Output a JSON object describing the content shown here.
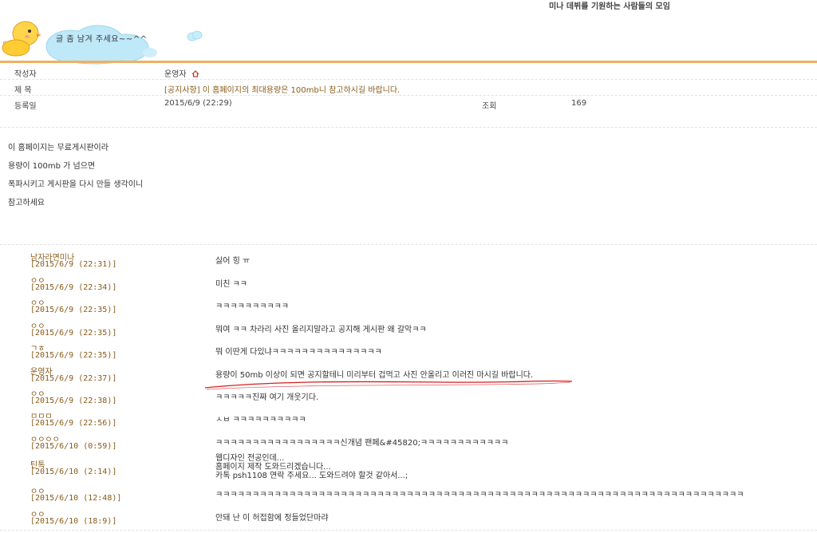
{
  "site_title": "미나 데뷔를 기원하는 사람들의 모임",
  "logo": {
    "cloud_text": "글 좀 남겨 주세요~~^^"
  },
  "post": {
    "writer_label": "작성자",
    "writer_value": "운영자",
    "subject_label": "제 목",
    "subject_value": "[공지사항] 이 홈페이지의 최대용량은 100mb니 참고하시길 바랍니다.",
    "date_label": "등록일",
    "date_value": "2015/6/9 (22:29)",
    "views_label": "조회",
    "views_value": "169",
    "body_lines": [
      "이 홈페이지는 무료게시판이라",
      "용량이 100mb 가 넘으면",
      "폭파시키고 게시판을 다시 만들 생각이니",
      "참고하세요"
    ]
  },
  "comments": [
    {
      "author": "남자라면미나",
      "date": "[2015/6/9 (22:31)]",
      "text": "싫어 힝 ㅠ"
    },
    {
      "author": "ㅇㅇ",
      "date": "[2015/6/9 (22:34)]",
      "text": "미친 ㅋㅋ"
    },
    {
      "author": "ㅇㅇ",
      "date": "[2015/6/9 (22:35)]",
      "text": "ㅋㅋㅋㅋㅋㅋㅋㅋㅋㅋ"
    },
    {
      "author": "ㅇㅇ",
      "date": "[2015/6/9 (22:35)]",
      "text": "뭐여 ㅋㅋ 차라리 사진 올리지말라고 공지해 게시판 왜 갈악ㅋㅋ"
    },
    {
      "author": "ㄱㅎ",
      "date": "[2015/6/9 (22:35)]",
      "text": "뭐 이딴게 다있냐ㅋㅋㅋㅋㅋㅋㅋㅋㅋㅋㅋㅋㅋㅋㅋ"
    },
    {
      "author": "운영자",
      "date": "[2015/6/9 (22:37)]",
      "text": "용량이 50mb 이상이 되면 공지할테니 미리부터 겁먹고 사진 안올리고 이러진 마시길 바랍니다."
    },
    {
      "author": "ㅇㅇ",
      "date": "[2015/6/9 (22:38)]",
      "text": "ㅋㅋㅋㅋㅋ진짜 여기 개웃기다."
    },
    {
      "author": "ㅁㅁㅁ",
      "date": "[2015/6/9 (22:56)]",
      "text": "ㅅㅂ ㅋㅋㅋㅋㅋㅋㅋㅋㅋㅋ"
    },
    {
      "author": "ㅇㅇㅇㅇ",
      "date": "[2015/6/10 (0:59)]",
      "text": "ㅋㅋㅋㅋㅋㅋㅋㅋㅋㅋㅋㅋㅋㅋㅋㅋㅋ신개념 팬페&#45820;ㅋㅋㅋㅋㅋㅋㅋㅋㅋㅋㅋㅋ"
    },
    {
      "author": "틴톡",
      "date": "[2015/6/10 (2:14)]",
      "text": "웹디자인 전공인데...\n홈페이지 제작 도와드리겠습니다...\n카톡 psh1108 연락 주세요... 도와드려야 할것 같아서...;"
    },
    {
      "author": "ㅇㅇ",
      "date": "[2015/6/10 (12:48)]",
      "text": "ㅋㅋㅋㅋㅋㅋㅋㅋㅋㅋㅋㅋㅋㅋㅋㅋㅋㅋㅋㅋㅋㅋㅋㅋㅋㅋㅋㅋㅋㅋㅋㅋㅋㅋㅋㅋㅋㅋㅋㅋㅋㅋㅋㅋㅋㅋㅋㅋㅋㅋㅋㅋㅋㅋㅋㅋㅋㅋㅋㅋㅋㅋㅋㅋㅋㅋㅋㅋㅋㅋㅋㅋ"
    },
    {
      "author": "ㅇㅇ",
      "date": "[2015/6/10 (18:9)]",
      "text": "안돼 난 이 허접함에 정들었단마랴"
    }
  ],
  "colors": {
    "accent_bar": "#f0b060",
    "meta_text": "#8a5b19",
    "annotation": "#d42020"
  }
}
